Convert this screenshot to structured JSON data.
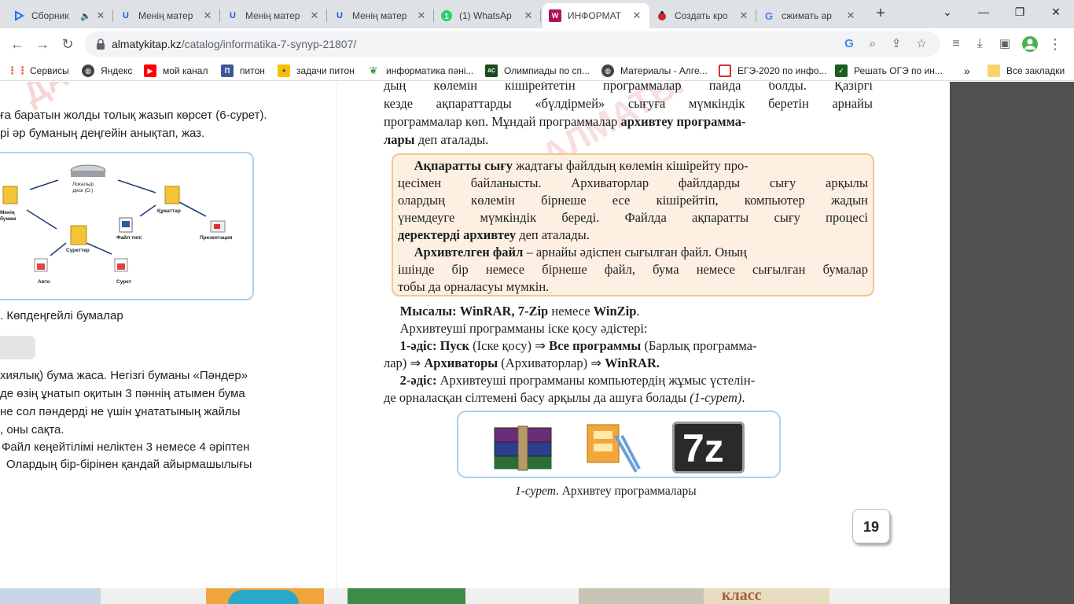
{
  "tabs": [
    {
      "title": "Сборник",
      "icon": "play-icon",
      "muted_icon": true,
      "active": false
    },
    {
      "title": "Менің матер",
      "icon": "u-icon",
      "active": false
    },
    {
      "title": "Менің матер",
      "icon": "u-icon",
      "active": false
    },
    {
      "title": "Менің матер",
      "icon": "u-icon",
      "active": false
    },
    {
      "title": "(1) WhatsAp",
      "icon": "whatsapp-icon",
      "active": false
    },
    {
      "title": "ИНФОРМАТ",
      "icon": "book-icon",
      "active": true
    },
    {
      "title": "Создать кро",
      "icon": "bug-icon",
      "active": false
    },
    {
      "title": "сжимать ар",
      "icon": "google-icon",
      "active": false
    }
  ],
  "address": {
    "host": "almatykitap.kz",
    "path": "/catalog/informatika-7-synyp-21807/"
  },
  "bookmarks": [
    {
      "label": "Сервисы",
      "icon": "apps-icon"
    },
    {
      "label": "Яндекс",
      "icon": "globe-icon"
    },
    {
      "label": "мой канал",
      "icon": "youtube-icon"
    },
    {
      "label": "питон",
      "icon": "bookmark-icon"
    },
    {
      "label": "задачи питон",
      "icon": "python-icon"
    },
    {
      "label": "информатика пəні...",
      "icon": "leaf-icon"
    },
    {
      "label": "Олимпиады по сп...",
      "icon": "acmp-icon"
    },
    {
      "label": "Материалы - Алге...",
      "icon": "globe-icon"
    },
    {
      "label": "ЕГЭ-2020 по инфо...",
      "icon": "square-icon"
    },
    {
      "label": "Решать ОГЭ по ин...",
      "icon": "reshu-icon"
    }
  ],
  "bookmarks_more": "»",
  "all_bookmarks": "Все закладки",
  "left_page": {
    "line1": "ға баратын жолды толық жазып көрсет (6-сурет).",
    "line2": "рі әр буманың деңгейін анықтап, жаз.",
    "diagram_labels": {
      "disk": "Локальді\nдиск (D:)",
      "my_folder": "Менің\nбумам",
      "documents": "Құжаттар",
      "file_type": "Файл типі",
      "presentation": "Презентация",
      "pictures": "Суреттер",
      "auto": "Авто",
      "picture": "Сурет"
    },
    "caption": ". Көпдеңгейлі бумалар",
    "para": [
      "хиялық) бума жаса. Негізгі буманы «Пəндер»",
      "де өзің ұнатып оқитын 3 пəннің атымен бума",
      "не сол пəндерді не үшін ұнататының жайлы",
      ", оны сақта.",
      "Файл кеңейтілімі неліктен 3 немесе 4 əріптен",
      "Олардың бір-бірінен қандай айырмашылығы"
    ]
  },
  "right_page": {
    "top_lines": [
      "дың көлемін кішірейтетін программалар пайда болды. Қазіргі",
      "кезде ақпараттарды «бүлдірмей» сығуға мүмкіндік беретін арнайы",
      "программалар көп. Мұндай программалар ",
      "архивтеу программа-",
      "лары",
      " деп аталады."
    ],
    "box": {
      "p1_term": "Ақпаратты сығу",
      "p1_l1": " жадтағы файлдың көлемін кішірейту про-",
      "p1_l2": "цесімен байланысты. Архиваторлар файлдарды сығу арқылы",
      "p1_l3": "олардың көлемін бірнеше есе кішірейтіп, компьютер жадын",
      "p1_l4": "үнемдеуге мүмкіндік береді. Файлда ақпаратты сығу процесі",
      "p1_term2": "деректерді архивтеу",
      "p1_l5": " деп аталады.",
      "p2_term": "Архивтелген файл",
      "p2_l1": " – арнайы əдіспен сығылған файл. Оның",
      "p2_l2": "ішінде бір немесе бірнеше файл, бума немесе сығылған бумалар",
      "p2_l3": "тобы да орналасуы мүмкін."
    },
    "example_label": "Мысалы:",
    "example_text": " WinRAR, 7-Zip",
    "example_or": " немесе ",
    "example_last": "WinZip",
    "example_dot": ".",
    "methods_intro": "Архивтеуші программаны іске қосу əдістері:",
    "m1_label": "1-əдіс:",
    "m1_a": " Пуск",
    "m1_b": " (Іске қосу) ⇒ ",
    "m1_c": "Все программы",
    "m1_d": " (Барлық программа-",
    "m1_e": "лар) ⇒ ",
    "m1_f": "Архиваторы",
    "m1_g": " (Архиваторлар) ⇒ ",
    "m1_h": "WinRAR.",
    "m2_label": "2-əдіс:",
    "m2_l1": " Архивтеуші программаны компьютердің жұмыс үстелін-",
    "m2_l2": "де орналасқан сілтемені басу арқылы да ашуға болады ",
    "m2_ref": "(1-сурет)",
    "m2_dot": ".",
    "icons": [
      "winrar-icon",
      "winzip-icon",
      "7zip-icon"
    ],
    "seven_zip_text": "7z",
    "figure_num": "1-сурет",
    "figure_caption": ". Архивтеу программалары",
    "page_number": "19"
  },
  "bottom_strip_text": "класс"
}
